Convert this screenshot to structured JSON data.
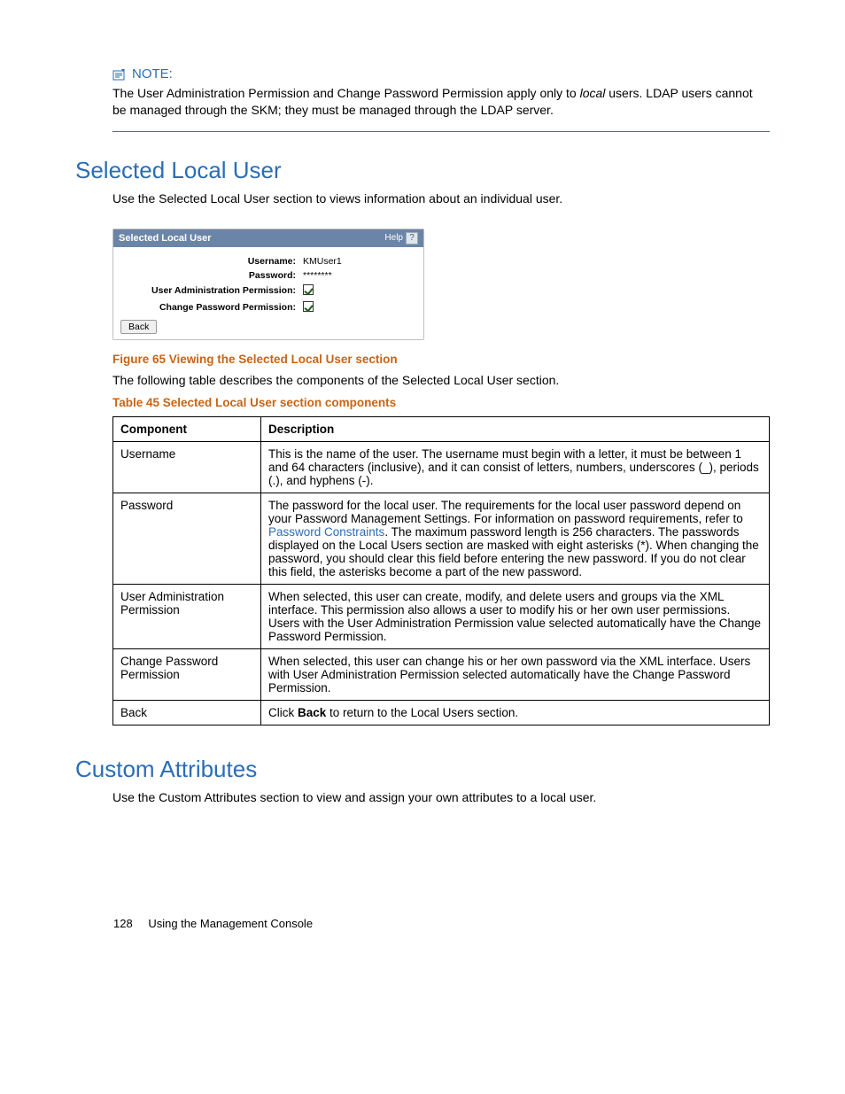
{
  "note": {
    "label": "NOTE:",
    "body_part1": "The User Administration Permission and Change Password Permission apply only to ",
    "body_italic": "local",
    "body_part2": " users.  LDAP users cannot be managed through the SKM; they must be managed through the LDAP server."
  },
  "section1": {
    "title": "Selected Local User",
    "intro": "Use the Selected Local User section to views information about an individual user."
  },
  "panel": {
    "header": "Selected Local User",
    "help_label": "Help",
    "rows": {
      "username_label": "Username:",
      "username_value": "KMUser1",
      "password_label": "Password:",
      "password_value": "********",
      "uap_label": "User Administration Permission:",
      "cpp_label": "Change Password Permission:"
    },
    "back_button": "Back"
  },
  "figure_caption": "Figure 65 Viewing the Selected Local User section",
  "table_intro": "The following table describes the components of the Selected Local User section.",
  "table_caption": "Table 45 Selected Local User section components",
  "table": {
    "head_component": "Component",
    "head_description": "Description",
    "rows": [
      {
        "component": "Username",
        "description": "This is the name of the user.  The username must begin with a letter, it must be between 1 and 64 characters (inclusive), and it can consist of letters, numbers, underscores (_), periods (.), and hyphens (-)."
      },
      {
        "component": "Password",
        "description_pre": "The password for the local user.  The requirements for the local user password depend on your Password Management Settings.  For information on password requirements, refer to ",
        "description_link": "Password Constraints",
        "description_post": ".  The maximum password length is 256 characters.  The passwords displayed on the Local Users section are masked with eight asterisks (*).  When changing the password, you should clear this field before entering the new password.  If you do not clear this field, the asterisks become a part of the new password."
      },
      {
        "component": "User Administration Permission",
        "description": "When selected, this user can create, modify, and delete users and groups via the XML interface.  This permission also allows a user to modify his or her own user permissions.  Users with the User Administration Permission value selected automatically have the Change Password Permission."
      },
      {
        "component": "Change Password Permission",
        "description": "When selected, this user can change his or her own password via the XML interface.  Users with User Administration Permission selected automatically have the Change Password Permission."
      },
      {
        "component": "Back",
        "description_pre": "Click ",
        "description_bold": "Back",
        "description_post": " to return to the Local Users section."
      }
    ]
  },
  "section2": {
    "title": "Custom Attributes",
    "intro": "Use the Custom Attributes section to view and assign your own attributes to a local user."
  },
  "footer": {
    "page": "128",
    "chapter": "Using the Management Console"
  }
}
